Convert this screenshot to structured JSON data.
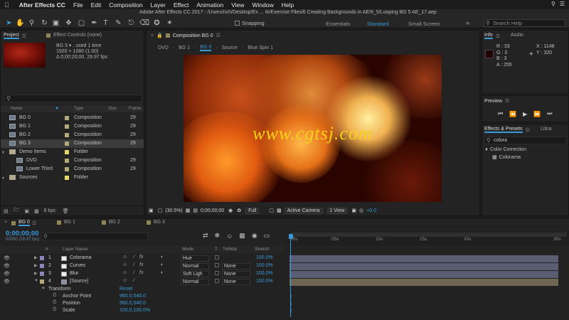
{
  "menubar": {
    "app": "After Effects CC",
    "items": [
      "File",
      "Edit",
      "Composition",
      "Layer",
      "Effect",
      "Animation",
      "View",
      "Window",
      "Help"
    ]
  },
  "window_title": "Adobe After Effects CC 2017 - /Users/rich/Desktop/Ex ... rk/Exercise Files/6 Creating Backgrounds in AE/6_5/Looping BG 5 AE_17.aep",
  "toolbar": {
    "snapping": "Snapping",
    "workspaces": [
      "Essentials",
      "Standard",
      "Small Screen"
    ],
    "search_placeholder": "Search Help"
  },
  "project": {
    "tab_label": "Project",
    "effect_controls_tab": "Effect Controls (none)",
    "selected_name": "BG 3 ▾ , used 1 time",
    "dimensions": "1920 × 1080 (1.00)",
    "duration": "Δ 0;00:20;00, 29.97 fps",
    "columns": [
      "Name",
      "Type",
      "Size",
      "Frame"
    ],
    "rows": [
      {
        "name": "BG 0",
        "type": "Composition",
        "frame": "29",
        "kind": "comp",
        "indent": 0
      },
      {
        "name": "BG 1",
        "type": "Composition",
        "frame": "29",
        "kind": "comp",
        "indent": 0
      },
      {
        "name": "BG 2",
        "type": "Composition",
        "frame": "29",
        "kind": "comp",
        "indent": 0
      },
      {
        "name": "BG 3",
        "type": "Composition",
        "frame": "29",
        "kind": "comp",
        "indent": 0,
        "selected": true
      },
      {
        "name": "Demo Items",
        "type": "Folder",
        "frame": "",
        "kind": "folder",
        "indent": 0
      },
      {
        "name": "DVD",
        "type": "Composition",
        "frame": "29",
        "kind": "comp",
        "indent": 1
      },
      {
        "name": "Lower Third",
        "type": "Composition",
        "frame": "29",
        "kind": "comp",
        "indent": 1
      },
      {
        "name": "Sources",
        "type": "Folder",
        "frame": "",
        "kind": "folder",
        "indent": 0
      }
    ],
    "bpc": "8 bpc"
  },
  "composition": {
    "tab_label": "Composition BG 0",
    "crumbs": [
      "DVD",
      "BG 1",
      "BG 0",
      "Source",
      "Blue Spin 1"
    ],
    "watermark": "www.cgtsj.com",
    "zoom": "(30.5%)",
    "timecode": "0;00;00;00",
    "resolution": "Full",
    "camera": "Active Camera",
    "views": "1 View",
    "offset": "+0.0"
  },
  "info": {
    "tab": "Info",
    "audio_tab": "Audio",
    "r": "R : 33",
    "g": "G : 3",
    "b": "B : 3",
    "a": "A : 255",
    "x": "X : 1148",
    "y": "Y : 320"
  },
  "preview": {
    "tab": "Preview"
  },
  "effects": {
    "tab": "Effects & Presets",
    "libra_tab": "Libra",
    "search_value": "colora",
    "category": "Color Correction",
    "item": "Colorama"
  },
  "timeline": {
    "tabs": [
      "BG 0",
      "BG 1",
      "BG 2",
      "BG 3"
    ],
    "time": "0;00;00;00",
    "frames": "00000 (29.97 fps)",
    "columns": [
      "#",
      "Layer Name",
      "Mode",
      "T",
      "TrkMat",
      "Stretch"
    ],
    "layers": [
      {
        "num": "1",
        "name": "Colorama",
        "mode": "Hue",
        "trkmat": "",
        "stretch": "100.0%"
      },
      {
        "num": "2",
        "name": "Curves",
        "mode": "Normal",
        "trkmat": "None",
        "stretch": "100.0%"
      },
      {
        "num": "3",
        "name": "Blur",
        "mode": "Soft Ligh",
        "trkmat": "None",
        "stretch": "100.0%"
      },
      {
        "num": "4",
        "name": "[Source]",
        "mode": "Normal",
        "trkmat": "None",
        "stretch": "100.0%"
      }
    ],
    "transform_label": "Transform",
    "reset_label": "Reset",
    "props": [
      {
        "name": "Anchor Point",
        "value": "960.0,540.0"
      },
      {
        "name": "Position",
        "value": "960.0,540.0"
      },
      {
        "name": "Scale",
        "value": "100.0,100.0%"
      }
    ],
    "ruler": [
      "00s",
      "05s",
      "10s",
      "15s",
      "20s",
      "30s"
    ]
  }
}
